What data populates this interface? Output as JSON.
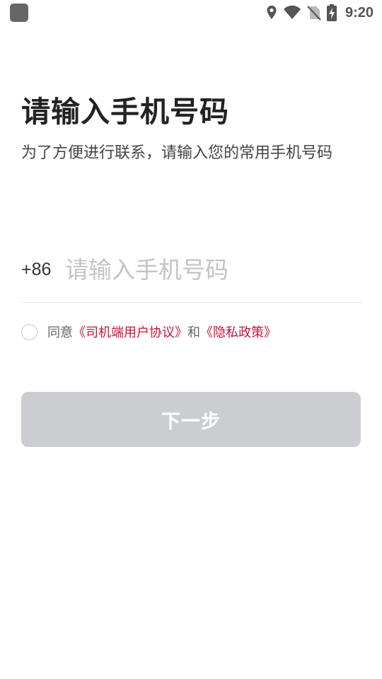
{
  "status_bar": {
    "time": "9:20",
    "icons": [
      "app-notification-icon",
      "location-icon",
      "wifi-icon",
      "no-sim-icon",
      "battery-charging-icon"
    ]
  },
  "page": {
    "title": "请输入手机号码",
    "subtitle": "为了方便进行联系，请输入您的常用手机号码"
  },
  "phone": {
    "prefix": "+86",
    "value": "",
    "placeholder": "请输入手机号码"
  },
  "agreement": {
    "checked": false,
    "prefix_text": "同意",
    "link1": "《司机端用户协议》",
    "conjunction": "和",
    "link2": "《隐私政策》"
  },
  "next_button": {
    "label": "下一步",
    "enabled": false
  },
  "colors": {
    "link": "#c8123c",
    "button_disabled": "#cbcdd1",
    "divider": "#e6e6e6"
  }
}
